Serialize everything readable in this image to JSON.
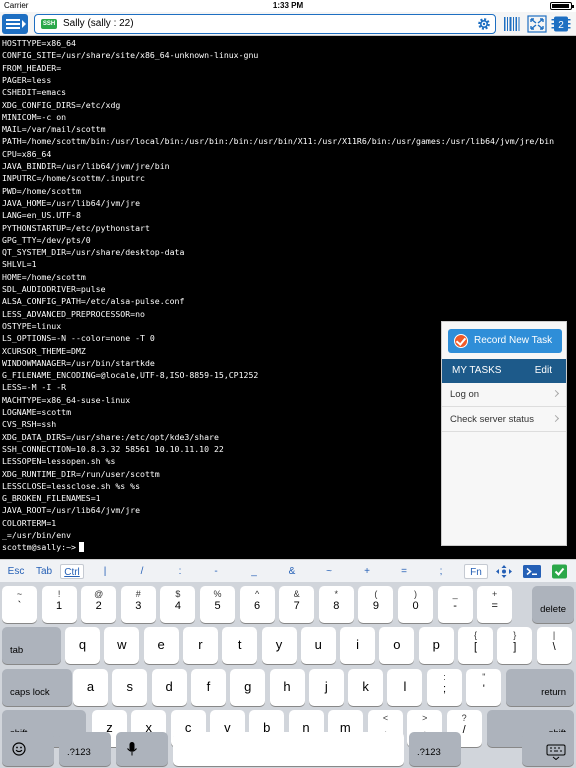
{
  "status_bar": {
    "carrier": "Carrier",
    "time": "1:33 PM"
  },
  "toolbar": {
    "session_badge": "SSH",
    "session_title": "Sally (sally : 22)",
    "icons": [
      "menu-icon",
      "gear-icon",
      "barcode-icon",
      "fullscreen-icon",
      "sessions-icon"
    ],
    "sessions_count": "2",
    "accent": "#1e6fc2"
  },
  "terminal": {
    "lines": [
      "HOSTTYPE=x86_64",
      "CONFIG_SITE=/usr/share/site/x86_64-unknown-linux-gnu",
      "FROM_HEADER=",
      "PAGER=less",
      "CSHEDIT=emacs",
      "XDG_CONFIG_DIRS=/etc/xdg",
      "MINICOM=-c on",
      "MAIL=/var/mail/scottm",
      "PATH=/home/scottm/bin:/usr/local/bin:/usr/bin:/bin:/usr/bin/X11:/usr/X11R6/bin:/usr/games:/usr/lib64/jvm/jre/bin",
      "CPU=x86_64",
      "JAVA_BINDIR=/usr/lib64/jvm/jre/bin",
      "INPUTRC=/home/scottm/.inputrc",
      "PWD=/home/scottm",
      "JAVA_HOME=/usr/lib64/jvm/jre",
      "LANG=en_US.UTF-8",
      "PYTHONSTARTUP=/etc/pythonstart",
      "GPG_TTY=/dev/pts/0",
      "QT_SYSTEM_DIR=/usr/share/desktop-data",
      "SHLVL=1",
      "HOME=/home/scottm",
      "SDL_AUDIODRIVER=pulse",
      "ALSA_CONFIG_PATH=/etc/alsa-pulse.conf",
      "LESS_ADVANCED_PREPROCESSOR=no",
      "OSTYPE=linux",
      "LS_OPTIONS=-N --color=none -T 0",
      "XCURSOR_THEME=DMZ",
      "WINDOWMANAGER=/usr/bin/startkde",
      "G_FILENAME_ENCODING=@locale,UTF-8,ISO-8859-15,CP1252",
      "LESS=-M -I -R",
      "MACHTYPE=x86_64-suse-linux",
      "LOGNAME=scottm",
      "CVS_RSH=ssh",
      "XDG_DATA_DIRS=/usr/share:/etc/opt/kde3/share",
      "SSH_CONNECTION=10.8.3.32 58561 10.10.11.10 22",
      "LESSOPEN=lessopen.sh %s",
      "XDG_RUNTIME_DIR=/run/user/scottm",
      "LESSCLOSE=lessclose.sh %s %s",
      "G_BROKEN_FILENAMES=1",
      "JAVA_ROOT=/usr/lib64/jvm/jre",
      "COLORTERM=1",
      "_=/usr/bin/env",
      "scottm@sally:~>"
    ]
  },
  "tasks_popover": {
    "record_label": "Record New Task",
    "header_title": "MY TASKS",
    "edit_label": "Edit",
    "items": [
      "Log on",
      "Check server status"
    ],
    "header_color": "#1d5a8a",
    "record_color": "#2f8ed8"
  },
  "extra_keys": {
    "keys": [
      "Esc",
      "Tab",
      "Ctrl",
      "|",
      "/",
      ":",
      "-",
      "_",
      "&",
      "~",
      "+",
      "=",
      ";",
      "Fn"
    ],
    "icons": [
      "move-cursor-icon",
      "terminal-icon",
      "done-checkbox-icon"
    ]
  },
  "keyboard": {
    "row1": [
      [
        "~",
        "`"
      ],
      [
        "!",
        "1"
      ],
      [
        "@",
        "2"
      ],
      [
        "#",
        "3"
      ],
      [
        "$",
        "4"
      ],
      [
        "%",
        "5"
      ],
      [
        "^",
        "6"
      ],
      [
        "&",
        "7"
      ],
      [
        "*",
        "8"
      ],
      [
        "(",
        "9"
      ],
      [
        ")",
        "0"
      ],
      [
        "_",
        "-"
      ],
      [
        "+",
        "="
      ]
    ],
    "delete": "delete",
    "tab": "tab",
    "row2": [
      "q",
      "w",
      "e",
      "r",
      "t",
      "y",
      "u",
      "i",
      "o",
      "p"
    ],
    "row2_extra": [
      [
        "{",
        "["
      ],
      [
        "}",
        "]"
      ],
      [
        "|",
        "\\"
      ]
    ],
    "caps": "caps lock",
    "row3": [
      "a",
      "s",
      "d",
      "f",
      "g",
      "h",
      "j",
      "k",
      "l"
    ],
    "row3_extra": [
      [
        ":",
        ";"
      ],
      [
        "\"",
        "'"
      ]
    ],
    "return": "return",
    "shift_left": "shift",
    "row4": [
      "z",
      "x",
      "c",
      "v",
      "b",
      "n",
      "m"
    ],
    "row4_extra": [
      [
        "<",
        ","
      ],
      [
        ">",
        "."
      ],
      [
        "?",
        "/"
      ]
    ],
    "shift_right": "shift",
    "numbers_label": ".?123",
    "icons": [
      "emoji-icon",
      "microphone-icon",
      "hide-keyboard-icon"
    ]
  }
}
